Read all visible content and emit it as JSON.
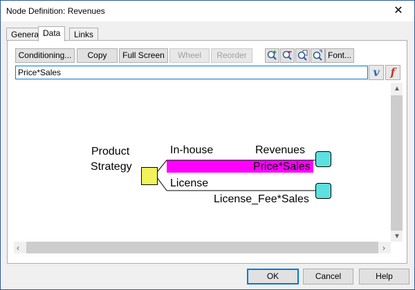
{
  "window": {
    "title": "Node Definition: Revenues"
  },
  "tabs": [
    {
      "label": "General"
    },
    {
      "label": "Data"
    },
    {
      "label": "Links"
    }
  ],
  "toolbar": {
    "conditioning": "Conditioning...",
    "copy": "Copy",
    "full_screen": "Full Screen",
    "wheel": "Wheel",
    "reorder": "Reorder",
    "font": "Font..."
  },
  "formula": {
    "value": "Price*Sales",
    "v_label": "v",
    "f_label": "f"
  },
  "tree": {
    "decision_label_line1": "Product",
    "decision_label_line2": "Strategy",
    "branch1": "In-house",
    "branch1_node": "Revenues",
    "branch1_value": "Price*Sales",
    "branch2": "License",
    "branch2_value": "License_Fee*Sales"
  },
  "buttons": {
    "ok": "OK",
    "cancel": "Cancel",
    "help": "Help"
  },
  "colors": {
    "decision": "#f2f25c",
    "terminal": "#5ee0e0",
    "highlight": "#ff00ff",
    "accent": "#0078d7"
  }
}
